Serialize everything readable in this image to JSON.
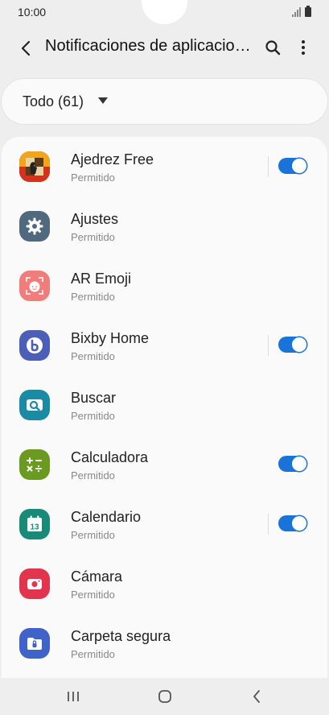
{
  "status_bar": {
    "time": "10:00"
  },
  "app_bar": {
    "title": "Notificaciones de aplicaciones"
  },
  "filter": {
    "label": "Todo (61)"
  },
  "apps": [
    {
      "name": "Ajedrez Free",
      "status": "Permitido",
      "icon": "chess-icon",
      "toggle": true
    },
    {
      "name": "Ajustes",
      "status": "Permitido",
      "icon": "settings-gear-icon",
      "toggle": false
    },
    {
      "name": "AR Emoji",
      "status": "Permitido",
      "icon": "ar-emoji-face-icon",
      "toggle": false
    },
    {
      "name": "Bixby Home",
      "status": "Permitido",
      "icon": "bixby-icon",
      "toggle": true
    },
    {
      "name": "Buscar",
      "status": "Permitido",
      "icon": "find-search-icon",
      "toggle": false
    },
    {
      "name": "Calculadora",
      "status": "Permitido",
      "icon": "calculator-icon",
      "toggle": true
    },
    {
      "name": "Calendario",
      "status": "Permitido",
      "icon": "calendar-icon",
      "toggle": true
    },
    {
      "name": "Cámara",
      "status": "Permitido",
      "icon": "camera-icon",
      "toggle": false
    },
    {
      "name": "Carpeta segura",
      "status": "Permitido",
      "icon": "secure-folder-icon",
      "toggle": false
    }
  ],
  "calendar_icon_day": "13",
  "colors": {
    "toggle_on": "#1a73d9",
    "settings": "#51697f",
    "ar_emoji": "#f07c7c",
    "bixby": "#4c5fb8",
    "buscar": "#1b8ba5",
    "calculadora": "#6a9a1f",
    "calendario": "#1a8a78",
    "camara": "#e2344c",
    "carpeta_segura": "#3f63c9"
  }
}
